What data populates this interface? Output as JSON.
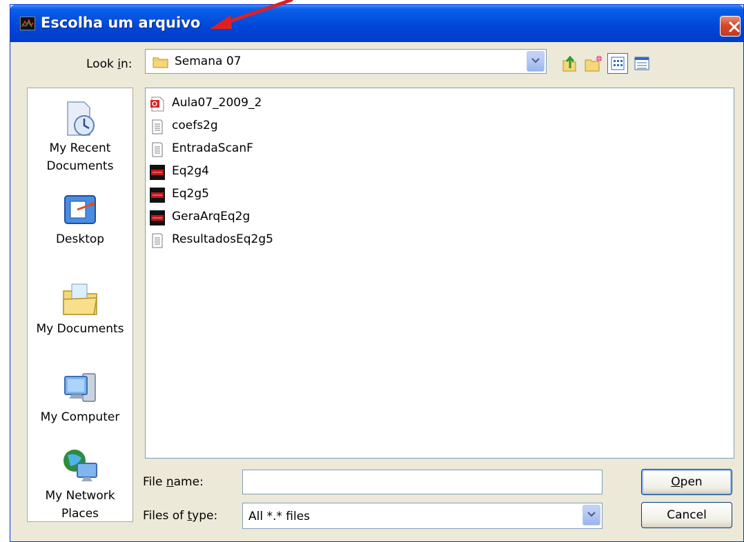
{
  "window": {
    "title": "Escolha um arquivo",
    "accent": "#0054E3",
    "annotation_color": "#E02020"
  },
  "lookin": {
    "label_pre": "Look ",
    "label_key": "i",
    "label_post": "n:",
    "value": "Semana 07"
  },
  "toolbar": {
    "icons": [
      "up-one-level-icon",
      "create-new-folder-icon",
      "list-view-icon",
      "details-view-icon"
    ]
  },
  "places": [
    {
      "label": "My Recent\nDocuments",
      "line1": "My Recent",
      "line2": "Documents",
      "icon": "recent-documents-icon"
    },
    {
      "line1": "Desktop",
      "line2": "",
      "icon": "desktop-icon"
    },
    {
      "line1": "My Documents",
      "line2": "",
      "icon": "my-documents-icon"
    },
    {
      "line1": "My Computer",
      "line2": "",
      "icon": "my-computer-icon"
    },
    {
      "line1": "My Network",
      "line2": "Places",
      "icon": "network-places-icon"
    }
  ],
  "files": [
    {
      "name": "Aula07_2009_2",
      "type": "pdf"
    },
    {
      "name": "coefs2g",
      "type": "text"
    },
    {
      "name": "EntradaScanF",
      "type": "text"
    },
    {
      "name": "Eq2g4",
      "type": "sce"
    },
    {
      "name": "Eq2g5",
      "type": "sce"
    },
    {
      "name": "GeraArqEq2g",
      "type": "sce"
    },
    {
      "name": "ResultadosEq2g5",
      "type": "text"
    }
  ],
  "filename": {
    "label_pre": "File ",
    "label_key": "n",
    "label_post": "ame:",
    "value": ""
  },
  "filetype": {
    "label_pre": "Files of ",
    "label_key": "t",
    "label_post": "ype:",
    "value": "All *.* files"
  },
  "buttons": {
    "open_key": "O",
    "open_rest": "pen",
    "cancel": "Cancel"
  }
}
